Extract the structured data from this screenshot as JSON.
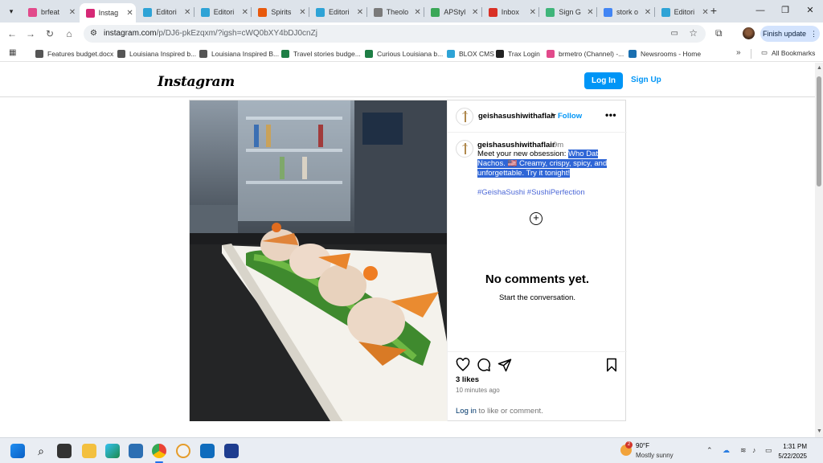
{
  "tabs": [
    {
      "label": "brfeat",
      "color": "#e24a8b"
    },
    {
      "label": "Instag",
      "color": "#d62976",
      "active": true
    },
    {
      "label": "Editori",
      "color": "#2ea3d6"
    },
    {
      "label": "Editori",
      "color": "#2ea3d6"
    },
    {
      "label": "Spirits",
      "color": "#e8590c"
    },
    {
      "label": "Editori",
      "color": "#2ea3d6"
    },
    {
      "label": "Theolo",
      "color": "#7a7a7a"
    },
    {
      "label": "APStyl",
      "color": "#3aa757"
    },
    {
      "label": "Inbox",
      "color": "#d93025"
    },
    {
      "label": "Sign G",
      "color": "#3fb57a"
    },
    {
      "label": "stork o",
      "color": "#4285f4"
    },
    {
      "label": "Editori",
      "color": "#2ea3d6"
    }
  ],
  "tab_close": "✕",
  "new_tab": "+",
  "url": {
    "domain": "instagram.com",
    "path": "/p/DJ6-pkEzqxm/?igsh=cWQ0bXY4bDJ0cnZj"
  },
  "finish_update": "Finish update",
  "bookmarks": [
    {
      "label": "Features budget.docx",
      "color": "#555555"
    },
    {
      "label": "Louisiana Inspired b...",
      "color": "#555555"
    },
    {
      "label": "Louisiana Inspired B...",
      "color": "#555555"
    },
    {
      "label": "Travel stories budge...",
      "color": "#1e7e45"
    },
    {
      "label": "Curious Louisiana b...",
      "color": "#1e7e45"
    },
    {
      "label": "BLOX CMS",
      "color": "#2ea3d6"
    },
    {
      "label": "Trax Login",
      "color": "#222222"
    },
    {
      "label": "brmetro (Channel) -...",
      "color": "#e24a8b"
    },
    {
      "label": "Newsrooms - Home",
      "color": "#1a6fb0"
    }
  ],
  "all_bookmarks": "All Bookmarks",
  "instagram": {
    "logo": "Instagram",
    "login": "Log In",
    "signup": "Sign Up",
    "username": "geishasushiwithaflair",
    "follow": "Follow",
    "time": "9m",
    "caption_plain": "Meet your new obsession: ",
    "caption_selected": "Who Dat Nachos. 🇺🇸 Creamy, crispy, spicy, and unforgettable. Try it tonight!",
    "hashtags": "#GeishaSushi #SushiPerfection",
    "no_comments": "No comments yet.",
    "start_conversation": "Start the conversation.",
    "likes": "3 likes",
    "ago": "10 minutes ago",
    "login_link": "Log in",
    "login_suffix": " to like or comment."
  },
  "taskbar": {
    "temperature": "90°F",
    "condition": "Mostly sunny",
    "weather_badge": "2",
    "time": "1:31 PM",
    "date": "5/22/2025"
  }
}
